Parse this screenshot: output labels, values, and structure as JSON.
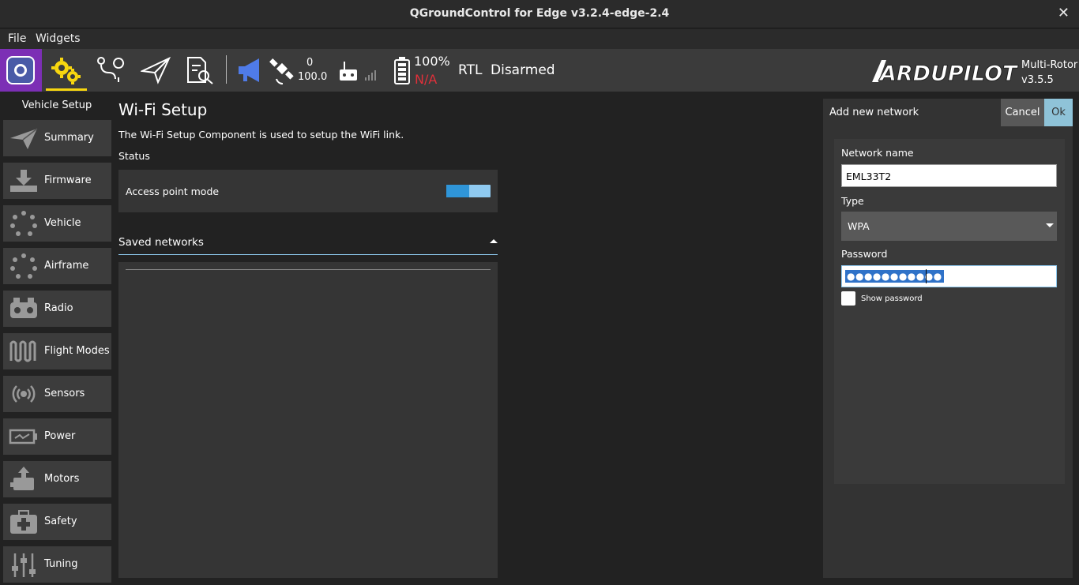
{
  "window": {
    "title": "QGroundControl for Edge v3.2.4-edge-2.4",
    "close_glyph": "✕"
  },
  "menu": {
    "file": "File",
    "widgets": "Widgets"
  },
  "toolbar": {
    "gps_count": "0",
    "gps_hdop": "100.0",
    "battery_pct": "100%",
    "battery_status": "N/A",
    "flight_mode": "RTL",
    "arm_state": "Disarmed",
    "vehicle_type": "Multi-Rotor",
    "firmware_version": "v3.5.5",
    "brand": "ARDUPILOT",
    "accent_color": "#f7d60f",
    "na_color": "#e0303a"
  },
  "sidebar": {
    "title": "Vehicle Setup",
    "items": [
      {
        "label": "Summary",
        "icon": "paper-plane-icon"
      },
      {
        "label": "Firmware",
        "icon": "download-icon"
      },
      {
        "label": "Vehicle",
        "icon": "dots-circle-icon"
      },
      {
        "label": "Airframe",
        "icon": "dots-circle-icon"
      },
      {
        "label": "Radio",
        "icon": "radio-icon"
      },
      {
        "label": "Flight Modes",
        "icon": "wave-icon"
      },
      {
        "label": "Sensors",
        "icon": "sensors-icon"
      },
      {
        "label": "Power",
        "icon": "battery-icon"
      },
      {
        "label": "Motors",
        "icon": "motor-icon"
      },
      {
        "label": "Safety",
        "icon": "first-aid-icon"
      },
      {
        "label": "Tuning",
        "icon": "sliders-icon"
      }
    ]
  },
  "main": {
    "title": "Wi-Fi Setup",
    "description": "The Wi-Fi Setup Component is used to setup the WiFi link.",
    "status_label": "Status",
    "access_point_label": "Access point mode",
    "access_point_on": true,
    "saved_networks_label": "Saved networks"
  },
  "dialog": {
    "title": "Add new network",
    "cancel_label": "Cancel",
    "ok_label": "Ok",
    "network_name_label": "Network name",
    "network_name_value": "EML33T2",
    "type_label": "Type",
    "type_value": "WPA",
    "password_label": "Password",
    "password_mask": "●●●●●●●●●●●",
    "show_password_label": "Show password",
    "show_password_checked": false
  }
}
